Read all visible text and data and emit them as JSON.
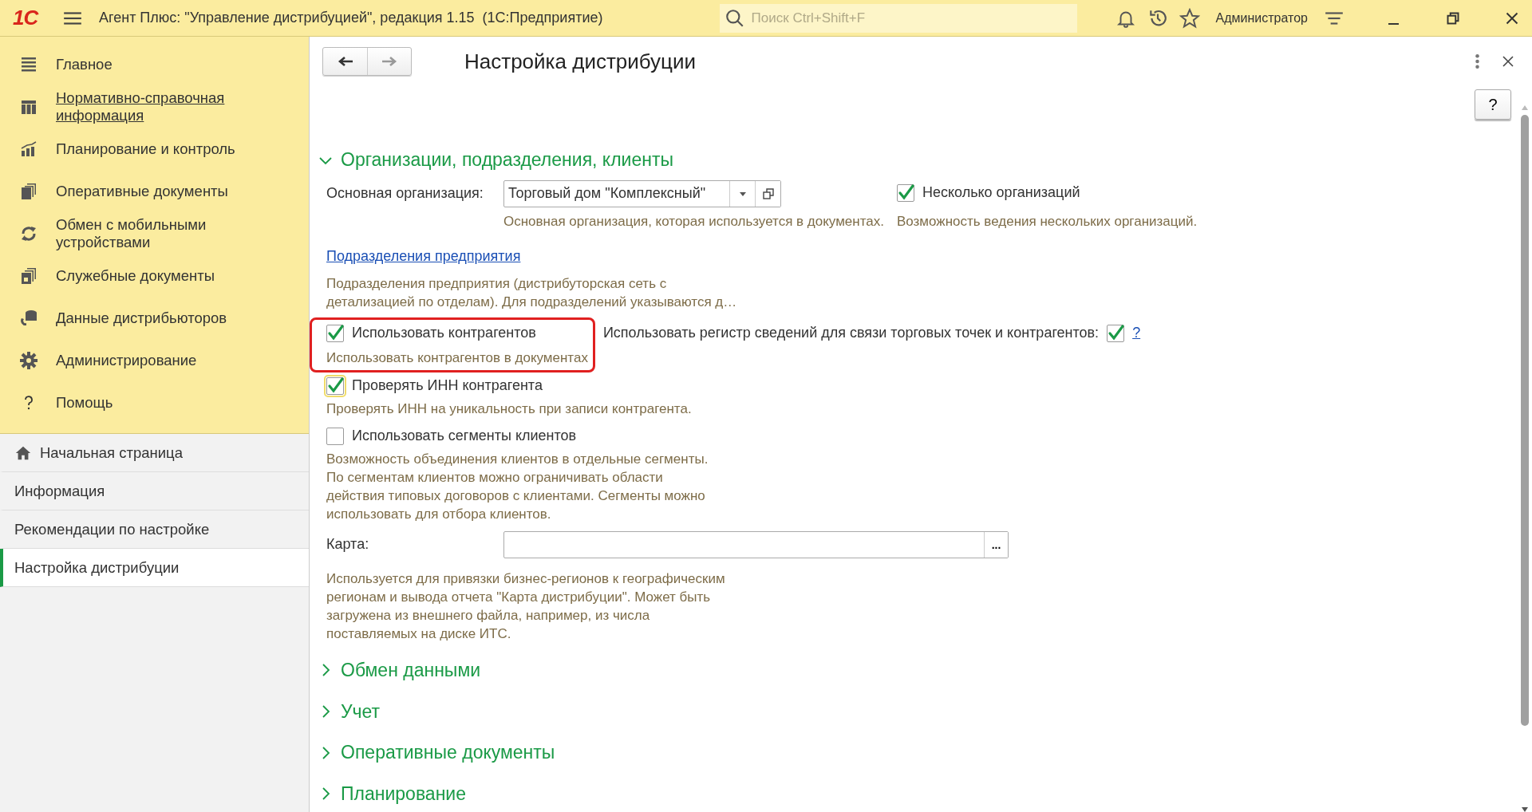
{
  "title_bar": {
    "logo": "1С",
    "title": "Агент Плюс: \"Управление дистрибуцией\", редакция 1.15  (1С:Предприятие)",
    "search": {
      "placeholder": "Поиск Ctrl+Shift+F"
    },
    "user": "Администратор"
  },
  "sidebar": {
    "sections": [
      {
        "label": "Главное",
        "hovered": false
      },
      {
        "label": "Нормативно-справочная информация",
        "hovered": true
      },
      {
        "label": "Планирование и контроль",
        "hovered": false
      },
      {
        "label": "Оперативные документы",
        "hovered": false
      },
      {
        "label": "Обмен с мобильными устройствами",
        "hovered": false
      },
      {
        "label": "Служебные документы",
        "hovered": false
      },
      {
        "label": "Данные дистрибьюторов",
        "hovered": false
      },
      {
        "label": "Администрирование",
        "hovered": false
      },
      {
        "label": "Помощь",
        "hovered": false
      }
    ],
    "open_pages": [
      {
        "kind": "home",
        "label": "Начальная страница",
        "selected": false
      },
      {
        "kind": "page",
        "label": "Информация",
        "selected": false
      },
      {
        "kind": "page",
        "label": "Рекомендации по настройке",
        "selected": false
      },
      {
        "kind": "page",
        "label": "Настройка дистрибуции",
        "selected": true
      }
    ]
  },
  "form": {
    "title": "Настройка дистрибуции",
    "help_button": "?",
    "sections": [
      {
        "title": "Организации, подразделения, клиенты",
        "expanded": true
      },
      {
        "title": "Обмен данными",
        "expanded": false
      },
      {
        "title": "Учет",
        "expanded": false
      },
      {
        "title": "Оперативные документы",
        "expanded": false
      },
      {
        "title": "Планирование",
        "expanded": false
      }
    ],
    "main_org": {
      "label": "Основная организация:",
      "value": "Торговый дом \"Комплексный\"",
      "hint": "Основная организация, которая используется в документах."
    },
    "multi_org": {
      "label": "Несколько организаций",
      "checked": true,
      "hint": "Возможность ведения нескольких организаций."
    },
    "divisions": {
      "link": "Подразделения предприятия",
      "hint": "Подразделения предприятия (дистрибуторская сеть с\nдетализацией по отделам). Для подразделений указываются д…"
    },
    "use_counterparties": {
      "label": "Использовать контрагентов",
      "checked": true,
      "hint": "Использовать контрагентов в документах",
      "highlighted": true
    },
    "register": {
      "label": "Использовать регистр сведений для связи торговых точек и контрагентов:",
      "checked": true,
      "help_link": "?"
    },
    "check_inn": {
      "label": "Проверять ИНН контрагента",
      "checked": true,
      "focused": true,
      "hint": "Проверять ИНН на уникальность при записи контрагента."
    },
    "segments": {
      "label": "Использовать сегменты клиентов",
      "checked": false,
      "hint": "Возможность объединения клиентов в отдельные сегменты.\nПо сегментам клиентов можно ограничивать области\nдействия типовых договоров с клиентами. Сегменты можно\nиспользовать для отбора клиентов."
    },
    "map": {
      "label": "Карта:",
      "button": "...",
      "hint": "Используется для привязки бизнес-регионов к географическим\nрегионам и вывода отчета \"Карта дистрибуции\". Может быть\nзагружена из внешнего файла, например, из числа\nпоставляемых на диске ИТС."
    }
  }
}
